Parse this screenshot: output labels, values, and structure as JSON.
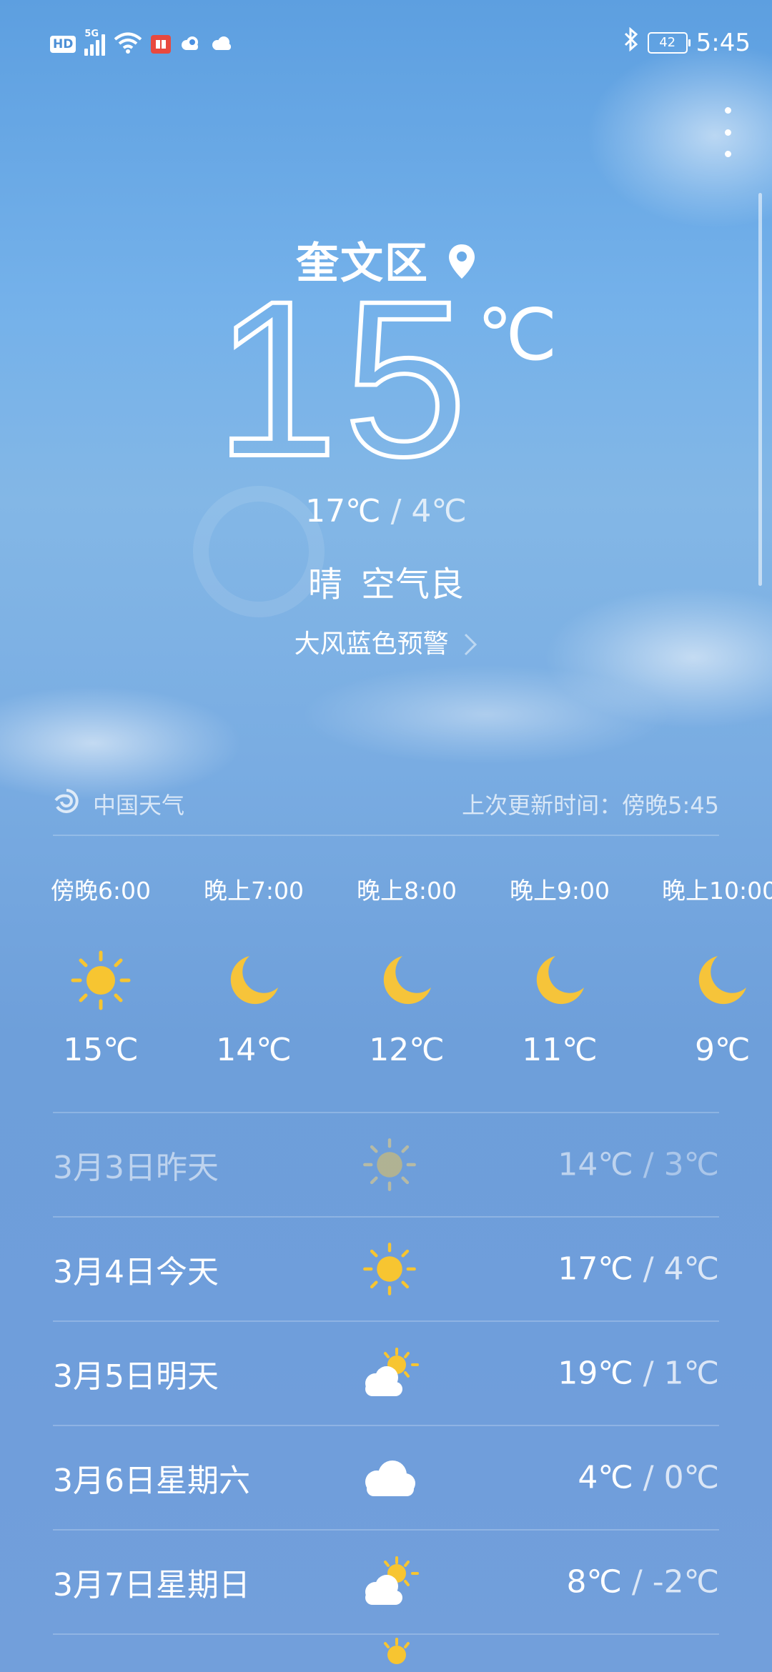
{
  "status_bar": {
    "hd": "HD",
    "network": "5G",
    "battery": "42",
    "time": "5:45",
    "icons": [
      "hd-icon",
      "signal-icon",
      "wifi-icon",
      "app-notification-icon",
      "cloud-icon",
      "cloud-icon",
      "bluetooth-icon",
      "battery-icon"
    ]
  },
  "location": {
    "name": "奎文区",
    "icon": "location-pin-icon"
  },
  "current": {
    "temp": "15",
    "unit": "℃",
    "high": "17℃",
    "separator": "/",
    "low": "4℃",
    "weather": "晴",
    "air_quality": "空气良",
    "alert": "大风蓝色预警"
  },
  "source": {
    "name": "中国天气",
    "updated": "上次更新时间：傍晚5:45"
  },
  "hourly": [
    {
      "time": "傍晚6:00",
      "icon": "sun-icon",
      "temp": "15℃"
    },
    {
      "time": "晚上7:00",
      "icon": "moon-icon",
      "temp": "14℃"
    },
    {
      "time": "晚上8:00",
      "icon": "moon-icon",
      "temp": "12℃"
    },
    {
      "time": "晚上9:00",
      "icon": "moon-icon",
      "temp": "11℃"
    },
    {
      "time": "晚上10:00",
      "icon": "moon-icon",
      "temp": "9℃"
    }
  ],
  "daily": [
    {
      "date": "3月3日昨天",
      "icon": "sun-icon",
      "high": "14℃",
      "low": "3℃",
      "past": true
    },
    {
      "date": "3月4日今天",
      "icon": "sun-icon",
      "high": "17℃",
      "low": "4℃",
      "past": false
    },
    {
      "date": "3月5日明天",
      "icon": "partly-cloudy-icon",
      "high": "19℃",
      "low": "1℃",
      "past": false
    },
    {
      "date": "3月6日星期六",
      "icon": "cloud-icon",
      "high": "4℃",
      "low": "0℃",
      "past": false
    },
    {
      "date": "3月7日星期日",
      "icon": "partly-cloudy-icon",
      "high": "8℃",
      "low": "-2℃",
      "past": false
    }
  ],
  "colors": {
    "sun": "#f7c531",
    "moon": "#f6c43a",
    "bg_top": "#5d9fe0",
    "bg_bottom": "#729fdb"
  }
}
